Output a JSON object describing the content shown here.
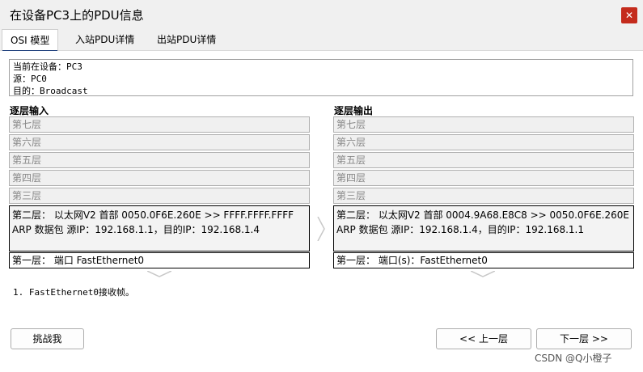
{
  "window": {
    "title": "在设备PC3上的PDU信息",
    "close_glyph": "✕"
  },
  "tabs": [
    {
      "label": "OSI 模型",
      "active": true
    },
    {
      "label": "入站PDU详情",
      "active": false
    },
    {
      "label": "出站PDU详情",
      "active": false
    }
  ],
  "info": {
    "device": "当前在设备：PC3",
    "source": "源：PC0",
    "dest": "目的：Broadcast"
  },
  "in_layers": {
    "title": "逐层输入",
    "l7": "第七层",
    "l6": "第六层",
    "l5": "第五层",
    "l4": "第四层",
    "l3": "第三层",
    "l2": "第二层： 以太网V2 首部 0050.0F6E.260E >> FFFF.FFFF.FFFF ARP 数据包 源IP：192.168.1.1，目的IP：192.168.1.4",
    "l1": "第一层： 端口 FastEthernet0"
  },
  "out_layers": {
    "title": "逐层输出",
    "l7": "第七层",
    "l6": "第六层",
    "l5": "第五层",
    "l4": "第四层",
    "l3": "第三层",
    "l2": "第二层： 以太网V2 首部 0004.9A68.E8C8 >> 0050.0F6E.260E ARP 数据包 源IP：192.168.1.4，目的IP：192.168.1.1",
    "l1": "第一层： 端口(s)：FastEthernet0"
  },
  "steps": [
    "1. FastEthernet0接收帧。"
  ],
  "buttons": {
    "challenge": "挑战我",
    "prev": "<< 上一层",
    "next": "下一层 >>"
  },
  "watermark": "CSDN @Q小橙子",
  "colors": {
    "close": "#c42b1c",
    "tab_underline": "#1a3b7a"
  }
}
